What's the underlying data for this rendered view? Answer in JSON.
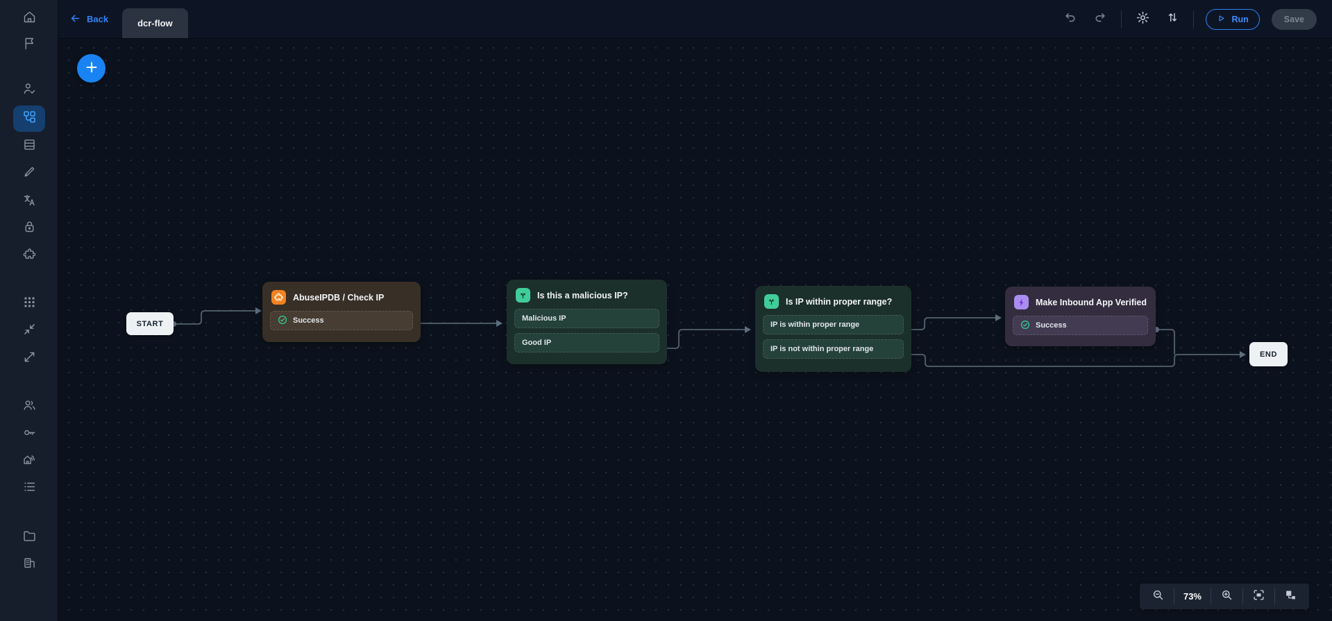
{
  "topbar": {
    "back_label": "Back",
    "flow_tab": "dcr-flow",
    "run_label": "Run",
    "save_label": "Save",
    "icons": [
      "undo-icon",
      "redo-icon",
      "gear-icon",
      "sort-vertical-icon",
      "play-icon"
    ]
  },
  "sidebar": {
    "active_item": "workflows",
    "icons": [
      "home-icon",
      "flag-icon",
      "user-check-icon",
      "workflow-icon",
      "table-rows-icon",
      "pen-icon",
      "translate-icon",
      "lock-icon",
      "puzzle-icon",
      "apps-grid-icon",
      "collapse-icon",
      "expand-icon",
      "users-icon",
      "key-icon",
      "home-signal-icon",
      "list-icon",
      "folder-icon",
      "organization-icon"
    ]
  },
  "flow": {
    "start_label": "START",
    "end_label": "END",
    "nodes": [
      {
        "id": "abuseipdb",
        "type": "action",
        "icon": "puzzle-icon",
        "icon_color": "#f28321",
        "title": "AbuseIPDB / Check IP",
        "outputs": [
          "Success"
        ]
      },
      {
        "id": "malicious-check",
        "type": "branch",
        "icon": "branch-icon",
        "icon_color": "#41cd9b",
        "title": "Is this a malicious IP?",
        "outputs": [
          "Malicious IP",
          "Good IP"
        ]
      },
      {
        "id": "range-check",
        "type": "branch",
        "icon": "branch-icon",
        "icon_color": "#41cd9b",
        "title": "Is IP within proper range?",
        "outputs": [
          "IP is within proper range",
          "IP is not within proper range"
        ]
      },
      {
        "id": "make-verified",
        "type": "action",
        "icon": "bolt-icon",
        "icon_color": "#ab8df0",
        "title": "Make Inbound App Verified",
        "outputs": [
          "Success"
        ]
      }
    ],
    "edges": [
      "START -> AbuseIPDB / Check IP",
      "AbuseIPDB Success -> Is this a malicious IP?",
      "Good IP -> Is IP within proper range?",
      "IP is within proper range -> Make Inbound App Verified",
      "IP is not within proper range -> END",
      "Make Inbound App Verified Success -> END"
    ]
  },
  "zoom_controls": {
    "level": "73%",
    "icons": [
      "zoom-out-icon",
      "zoom-in-icon",
      "fit-screen-icon",
      "auto-layout-icon"
    ]
  },
  "colors": {
    "accent_blue": "#2f81f7",
    "node_orange": "#f28321",
    "node_green": "#41cd9b",
    "node_purple": "#ab8df0",
    "success_green": "#34d399",
    "edge_gray": "#52636f"
  }
}
